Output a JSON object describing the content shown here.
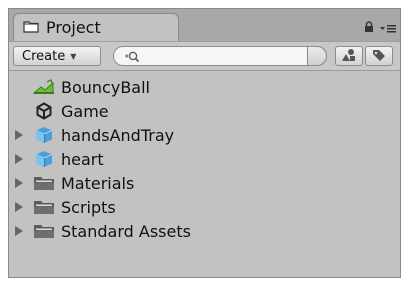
{
  "window": {
    "tab_label": "Project",
    "tab_icon": "folder-icon",
    "controls": [
      "lock-icon",
      "panel-menu-icon"
    ]
  },
  "toolbar": {
    "create_label": "Create",
    "search_placeholder": "",
    "type_filter_icon": "shapes-icon",
    "label_filter_icon": "tag-icon"
  },
  "tree": {
    "items": [
      {
        "label": "BouncyBall",
        "icon": "scene-icon",
        "expandable": false
      },
      {
        "label": "Game",
        "icon": "unity-icon",
        "expandable": false
      },
      {
        "label": "handsAndTray",
        "icon": "prefab-icon",
        "expandable": true
      },
      {
        "label": "heart",
        "icon": "prefab-icon",
        "expandable": true
      },
      {
        "label": "Materials",
        "icon": "folder-icon",
        "expandable": true
      },
      {
        "label": "Scripts",
        "icon": "folder-icon",
        "expandable": true
      },
      {
        "label": "Standard Assets",
        "icon": "folder-icon",
        "expandable": true
      }
    ]
  },
  "colors": {
    "panel_bg": "#c2c2c2",
    "tabbar_bg": "#a8a8a8",
    "folder": "#5c5c5c",
    "prefab": "#4a9fd8",
    "scene": "#6bbf3a"
  }
}
